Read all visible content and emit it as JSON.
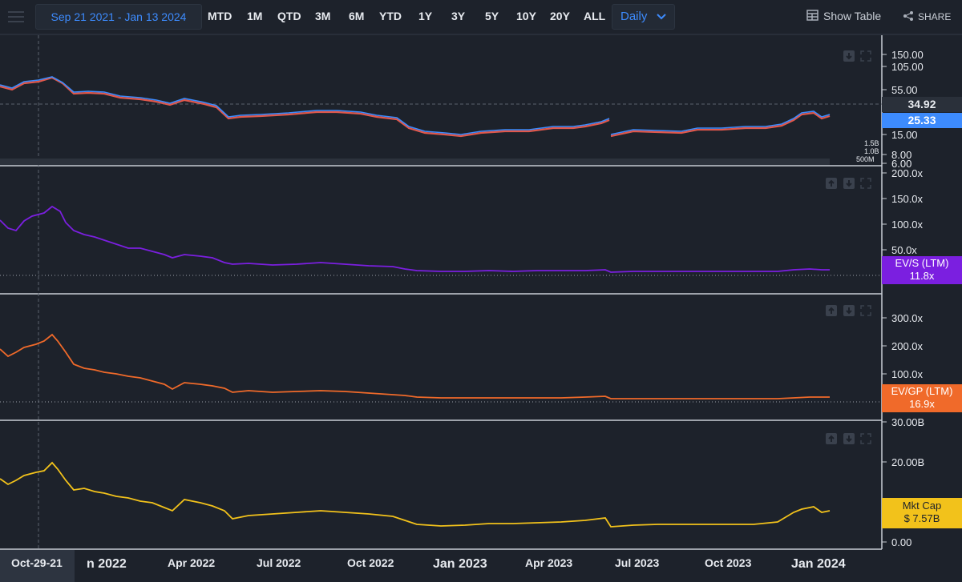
{
  "toolbar": {
    "date_range": "Sep 21 2021 - Jan 13 2024",
    "ranges": [
      "MTD",
      "1M",
      "QTD",
      "3M",
      "6M",
      "YTD",
      "1Y",
      "3Y",
      "5Y",
      "10Y",
      "20Y",
      "ALL"
    ],
    "interval": "Daily",
    "show_table": "Show Table",
    "share": "SHARE"
  },
  "colors": {
    "background": "#1d222b",
    "accent": "#3d8bfd",
    "ev_s": "#7b1fe0",
    "ev_gp": "#f06a2a",
    "mkt_cap": "#f2c21b"
  },
  "panes": {
    "price": {
      "y_ticks": [
        "150.00",
        "105.00",
        "55.00",
        "15.00",
        "8.00",
        "6.00"
      ],
      "volume_ticks": [
        "1.5B",
        "1.0B",
        "500M"
      ],
      "last_close": "25.33",
      "crosshair_value": "34.92"
    },
    "ev_s": {
      "y_ticks": [
        "200.0x",
        "150.0x",
        "100.0x",
        "50.0x"
      ],
      "label": "EV/S (LTM)",
      "value": "11.8x",
      "zero_label": "0.0x"
    },
    "ev_gp": {
      "y_ticks": [
        "300.0x",
        "200.0x",
        "100.0x"
      ],
      "label": "EV/GP (LTM)",
      "value": "16.9x",
      "zero_label": "0.0x"
    },
    "mkt_cap": {
      "y_ticks": [
        "30.00B",
        "20.00B",
        "0.00"
      ],
      "label": "Mkt Cap",
      "value": "$ 7.57B"
    }
  },
  "x_axis": {
    "crosshair_date": "Oct-29-21",
    "ticks": [
      "n 2022",
      "Apr 2022",
      "Jul 2022",
      "Oct 2022",
      "Jan 2023",
      "Apr 2023",
      "Jul 2023",
      "Oct 2023",
      "Jan 2024"
    ]
  },
  "chart_data": {
    "type": "line",
    "x_start": "2021-09-21",
    "x_end": "2024-01-12",
    "series": [
      {
        "name": "EV/S (LTM)",
        "last": 11.8,
        "values": [
          85,
          95,
          110,
          130,
          105,
          80,
          65,
          55,
          45,
          40,
          30,
          25,
          22,
          20,
          18,
          16,
          14,
          13,
          12,
          12,
          11,
          11,
          11,
          12,
          12,
          11.8
        ]
      },
      {
        "name": "EV/GP (LTM)",
        "last": 16.9,
        "values": [
          160,
          200,
          230,
          250,
          170,
          125,
          105,
          90,
          75,
          65,
          50,
          45,
          40,
          35,
          30,
          25,
          22,
          20,
          18,
          17,
          16,
          16,
          16,
          17,
          17,
          16.9
        ]
      },
      {
        "name": "Mkt Cap",
        "last": 7.57,
        "values": [
          15,
          17,
          19,
          20,
          14,
          12,
          11,
          10,
          9,
          8,
          7,
          6.8,
          6.5,
          6.2,
          5,
          4.5,
          4.2,
          4,
          4.5,
          4.8,
          5.2,
          4.5,
          5,
          5.5,
          7.8,
          7.57
        ]
      }
    ]
  }
}
